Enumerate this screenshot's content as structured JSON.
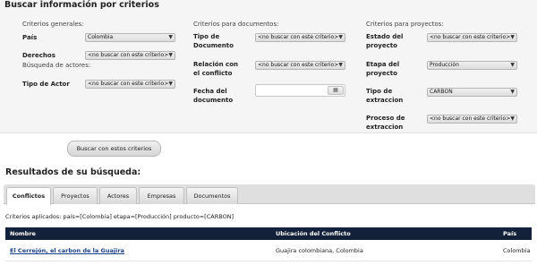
{
  "search": {
    "title": "Buscar información por criterios",
    "general": {
      "title": "Criterios generales:",
      "pais_label": "País",
      "pais_value": "Colombia",
      "derechos_label": "Derechos",
      "derechos_value": "<no buscar con este criterio>"
    },
    "actores": {
      "title": "Búsqueda de actores:",
      "tipo_actor_label": "Tipo de Actor",
      "tipo_actor_value": "<no buscar con este criterio>"
    },
    "documentos": {
      "title": "Criterios para documentos:",
      "tipo_doc_label_1": "Tipo de",
      "tipo_doc_label_2": "Documento",
      "tipo_doc_value": "<no buscar con este criterio>",
      "relacion_label_1": "Relación con",
      "relacion_label_2": "el conflicto",
      "relacion_value": "<no buscar con este criterio>",
      "fecha_label_1": "Fecha del",
      "fecha_label_2": "documento",
      "fecha_value": ""
    },
    "proyectos": {
      "title": "Criterios para proyectos:",
      "estado_label_1": "Estado del",
      "estado_label_2": "proyecto",
      "estado_value": "<no buscar con este criterio>",
      "etapa_label_1": "Etapa del",
      "etapa_label_2": "proyecto",
      "etapa_value": "Producción",
      "tipo_ext_label_1": "Tipo de",
      "tipo_ext_label_2": "extraccion",
      "tipo_ext_value": "CARBON",
      "proceso_label_1": "Proceso de",
      "proceso_label_2": "extraccion",
      "proceso_value": "<no buscar con este criterio>"
    },
    "button_label": "Buscar con estos criterios"
  },
  "results": {
    "title": "Resultados de su búsqueda:",
    "tabs": [
      "Conflictos",
      "Proyectos",
      "Actores",
      "Empresas",
      "Documentos"
    ],
    "criteria_text": "Criterios aplicados: país=[Colombia] etapa=[Producción] producto=[CARBON]",
    "columns": [
      "Nombre",
      "Ubicación del Conflicto",
      "País"
    ],
    "rows": [
      {
        "nombre": "El Cerrejón, el carbon de la Guajira",
        "ubicacion": "Guajira colombiana, Colombia",
        "pais": "Colombia"
      }
    ]
  }
}
